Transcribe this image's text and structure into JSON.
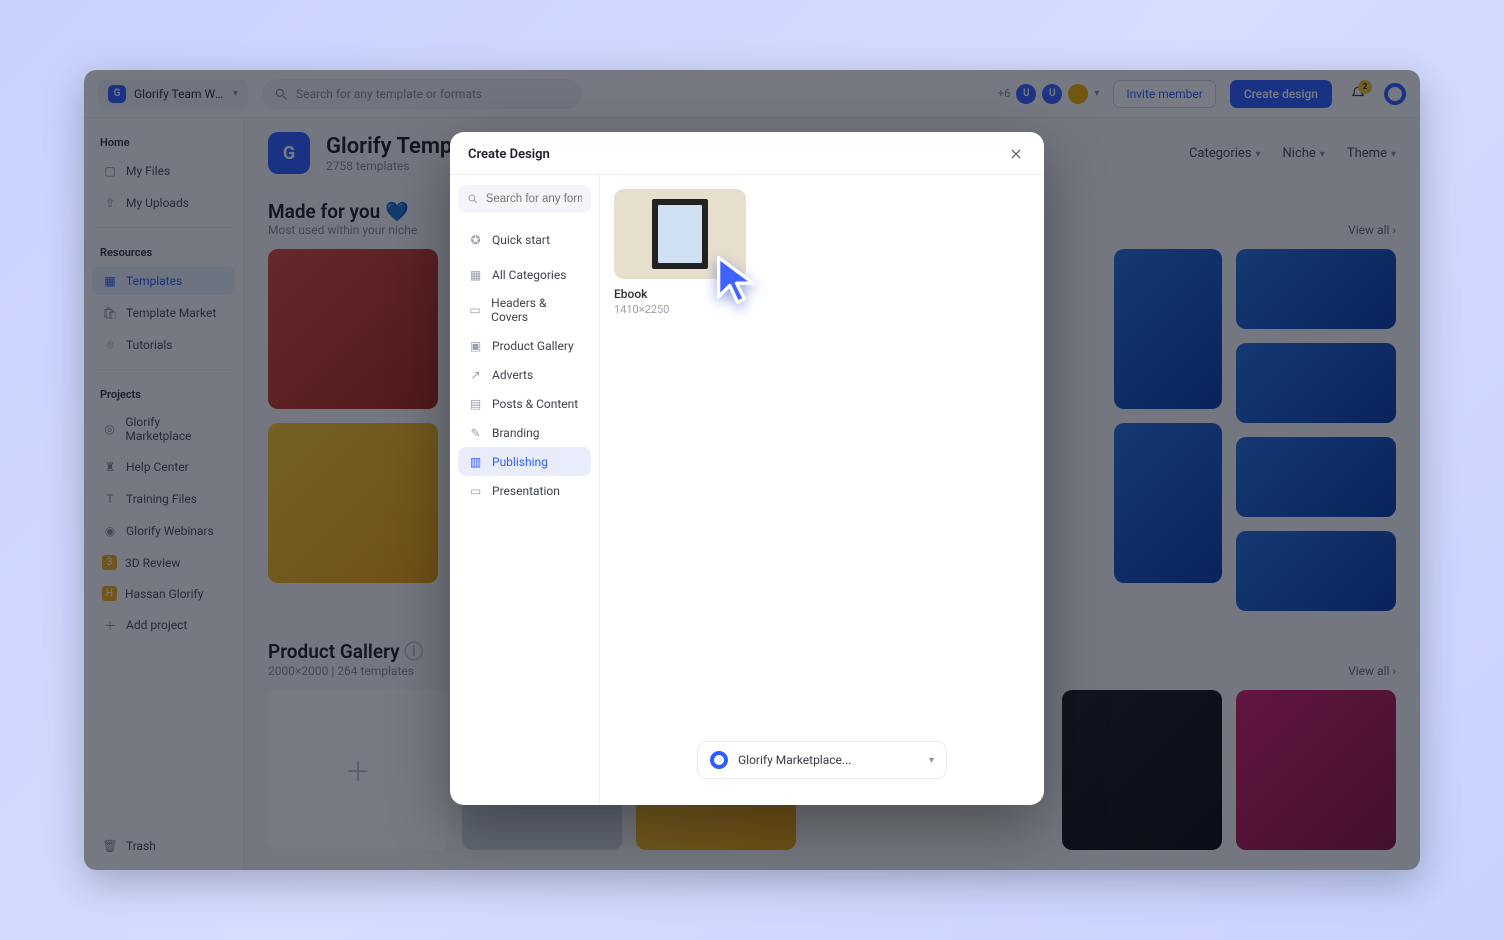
{
  "topbar": {
    "workspace_label": "Glorify Team Wor...",
    "workspace_badge": "G",
    "search_placeholder": "Search for any template or formats",
    "avatar_extra": "+6",
    "avatar1": "U",
    "avatar2": "U",
    "invite_label": "Invite member",
    "create_label": "Create design",
    "notif_count": "2"
  },
  "sidebar": {
    "home_section": "Home",
    "home": [
      {
        "icon": "file-icon",
        "label": "My Files"
      },
      {
        "icon": "upload-icon",
        "label": "My Uploads"
      }
    ],
    "resources_section": "Resources",
    "resources": [
      {
        "icon": "grid-icon",
        "label": "Templates",
        "active": true
      },
      {
        "icon": "bag-icon",
        "label": "Template Market"
      },
      {
        "icon": "play-icon",
        "label": "Tutorials"
      }
    ],
    "projects_section": "Projects",
    "projects": [
      {
        "icon": "logo-icon",
        "label": "Glorify Marketplace"
      },
      {
        "icon": "helmet-icon",
        "label": "Help Center"
      },
      {
        "icon": "box-t-icon",
        "label": "Training Files"
      },
      {
        "icon": "spiral-icon",
        "label": "Glorify Webinars"
      },
      {
        "icon": "box-3-icon",
        "label": "3D Review"
      },
      {
        "icon": "box-h-icon",
        "label": "Hassan Glorify"
      },
      {
        "icon": "plus-icon",
        "label": "Add project"
      }
    ],
    "trash_label": "Trash"
  },
  "hero": {
    "badge": "G",
    "title": "Glorify Templates",
    "subtitle": "2758 templates",
    "filters": [
      {
        "label": "Categories"
      },
      {
        "label": "Niche"
      },
      {
        "label": "Theme"
      }
    ]
  },
  "section_made": {
    "title": "Made for you",
    "heart": "💙",
    "subtitle": "Most used within your niche",
    "view_all": "View all"
  },
  "section_gallery": {
    "title": "Product Gallery",
    "subtitle": "2000×2000 | 264 templates",
    "view_all": "View all"
  },
  "modal": {
    "title": "Create Design",
    "search_placeholder": "Search for any format",
    "categories": [
      {
        "label": "Quick start"
      },
      {
        "label": "All Categories"
      },
      {
        "label": "Headers & Covers"
      },
      {
        "label": "Product Gallery"
      },
      {
        "label": "Adverts"
      },
      {
        "label": "Posts & Content"
      },
      {
        "label": "Branding"
      },
      {
        "label": "Publishing",
        "active": true
      },
      {
        "label": "Presentation"
      }
    ],
    "tile": {
      "label": "Ebook",
      "dimensions": "1410×2250"
    },
    "footer_select": "Glorify Marketplace..."
  }
}
